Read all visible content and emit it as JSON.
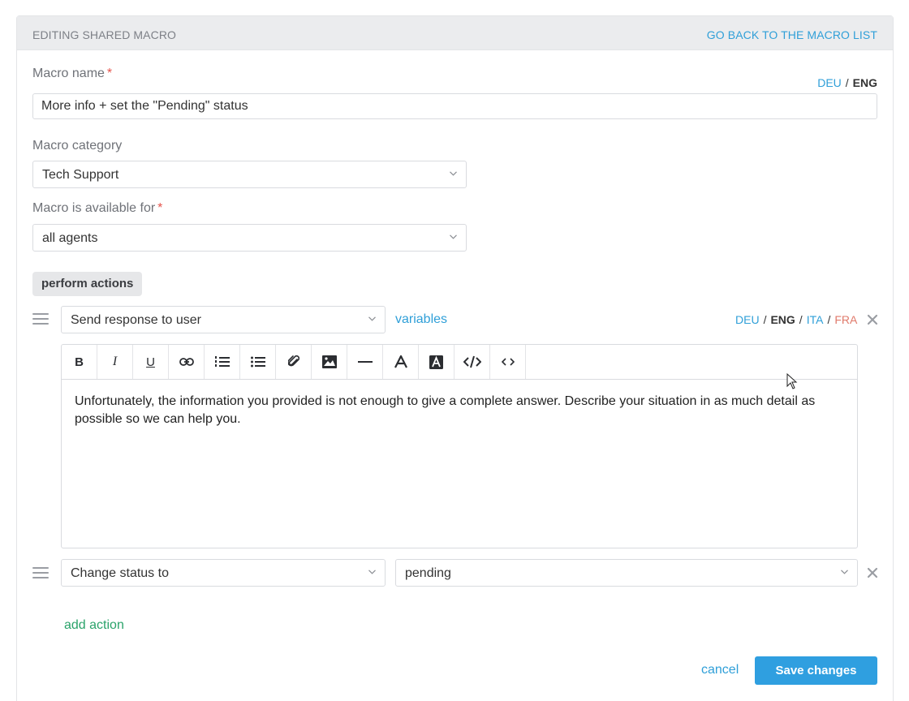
{
  "header": {
    "title": "EDITING SHARED MACRO",
    "back_link": "GO BACK TO THE MACRO LIST"
  },
  "macro_name": {
    "label": "Macro name",
    "required_mark": "*",
    "value": "More info + set the \"Pending\" status",
    "languages": [
      {
        "code": "DEU",
        "state": "link"
      },
      {
        "code": "ENG",
        "state": "active"
      }
    ],
    "separator": "/"
  },
  "macro_category": {
    "label": "Macro category",
    "selected": "Tech Support"
  },
  "availability": {
    "label": "Macro is available for",
    "required_mark": "*",
    "selected": "all agents"
  },
  "actions_section": {
    "pill_label": "perform actions"
  },
  "action_1": {
    "selected": "Send response to user",
    "variables_link": "variables",
    "languages": [
      {
        "code": "DEU",
        "state": "link"
      },
      {
        "code": "ENG",
        "state": "active"
      },
      {
        "code": "ITA",
        "state": "link"
      },
      {
        "code": "FRA",
        "state": "warn"
      }
    ],
    "separator": "/",
    "editor_text": "Unfortunately, the information you provided is not enough to give a complete answer. Describe your situation in as much detail as possible so we can help you.",
    "toolbar": {
      "bold": "B",
      "italic": "I",
      "underline": "U"
    }
  },
  "action_2": {
    "selected": "Change status to",
    "value_selected": "pending"
  },
  "footer": {
    "add_action": "add action",
    "cancel": "cancel",
    "save": "Save changes"
  },
  "icons": {
    "toolbar": [
      "bold-icon",
      "italic-icon",
      "underline-icon",
      "link-icon",
      "ordered-list-icon",
      "bullet-list-icon",
      "attachment-icon",
      "image-icon",
      "horizontal-rule-icon",
      "font-icon",
      "text-background-icon",
      "code-icon",
      "source-icon"
    ],
    "other": [
      "chevron-down-icon",
      "drag-handle-icon",
      "close-icon",
      "mouse-cursor-icon"
    ]
  },
  "colors": {
    "accent": "#2f9fd8",
    "primary_button": "#2f9fe0",
    "required": "#e5534b",
    "add_action": "#2aa36a",
    "lang_warn": "#e07a6b",
    "header_bg": "#ebecee"
  }
}
